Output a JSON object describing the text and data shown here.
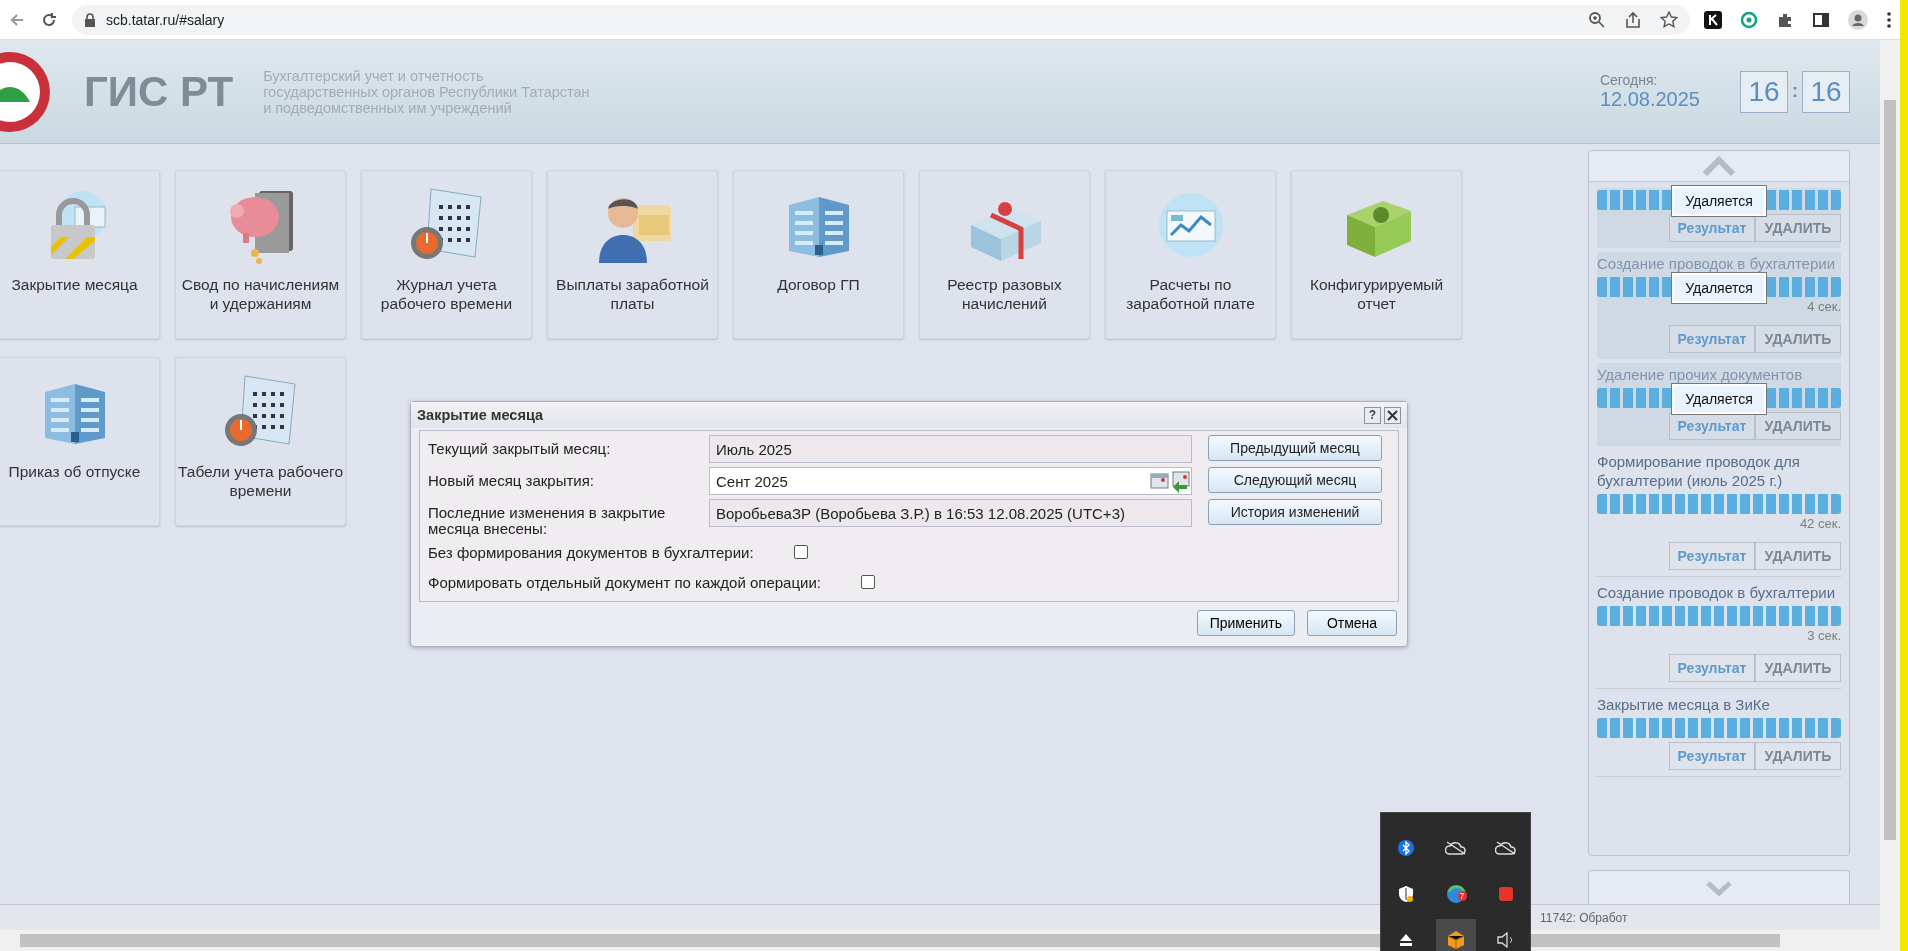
{
  "browser": {
    "url": "scb.tatar.ru/#salary"
  },
  "header": {
    "logo_text": "ГИС РТ",
    "subtitle": [
      "Бухгалтерский учет и отчетность",
      "государственных органов Республики Татарстан",
      "и подведомственных им учреждений"
    ],
    "today_label": "Сегодня:",
    "date": "12.08.2025",
    "clock": {
      "hours": "16",
      "separator": ":",
      "minutes": "16"
    }
  },
  "tiles": [
    {
      "label": "Закрытие месяца"
    },
    {
      "label": "Свод по начислениям и удержаниям"
    },
    {
      "label": "Журнал учета рабочего времени"
    },
    {
      "label": "Выплаты заработной платы"
    },
    {
      "label": "Договор ГП"
    },
    {
      "label": "Реестр разовых начислений"
    },
    {
      "label": "Расчеты по заработной плате"
    },
    {
      "label": "Конфигурируемый отчет"
    },
    {
      "label": "Приказ об отпуске"
    },
    {
      "label": "Табели учета рабочего времени"
    }
  ],
  "dialog": {
    "title": "Закрытие месяца",
    "help": "?",
    "fields": [
      {
        "label": "Текущий закрытый месяц:",
        "value": "Июль 2025",
        "kind": "text"
      },
      {
        "label": "Новый месяц закрытия:",
        "value": "Сент 2025",
        "kind": "date"
      },
      {
        "label": "Последние изменения в закрытие месяца внесены:",
        "value": "ВоробьеваЗР (Воробьева З.Р.) в 16:53 12.08.2025 (UTC+3)",
        "kind": "text"
      }
    ],
    "side_buttons": [
      "Предыдущий месяц",
      "Следующий месяц",
      "История изменений"
    ],
    "checkboxes": [
      {
        "label": "Без формирования документов в бухгалтерии:",
        "checked": false
      },
      {
        "label": "Формировать отдельный документ по каждой операции:",
        "checked": false
      }
    ],
    "buttons": [
      "Применить",
      "Отмена"
    ]
  },
  "tasks": [
    {
      "deleting": true,
      "level": 1,
      "overlay": "Удаляется",
      "result": "Результат",
      "delete": "УДАЛИТЬ"
    },
    {
      "title": "Создание проводок в бухгалтерии",
      "deleting": true,
      "level": 1,
      "time": "4 сек.",
      "overlay": "Удаляется",
      "result": "Результат",
      "delete": "УДАЛИТЬ"
    },
    {
      "title": "Удаление прочих документов",
      "deleting": true,
      "level": 1,
      "overlay": "Удаляется",
      "result": "Результат",
      "delete": "УДАЛИТЬ"
    },
    {
      "title": "Формирование проводок для бухгалтерии (июль 2025 г.)",
      "deleting": false,
      "level": 1,
      "time": "42 сек.",
      "result": "Результат",
      "delete": "УДАЛИТЬ"
    },
    {
      "title": "Создание проводок в бухгалтерии",
      "deleting": false,
      "level": 1,
      "time": "3 сек.",
      "result": "Результат",
      "delete": "УДАЛИТЬ"
    },
    {
      "title": "Закрытие месяца в ЗиКе",
      "deleting": false,
      "level": 1,
      "result": "Результат",
      "delete": "УДАЛИТЬ"
    }
  ],
  "status_bar": {
    "text": "11742: Обработ"
  },
  "tray": {
    "badge": "7"
  }
}
